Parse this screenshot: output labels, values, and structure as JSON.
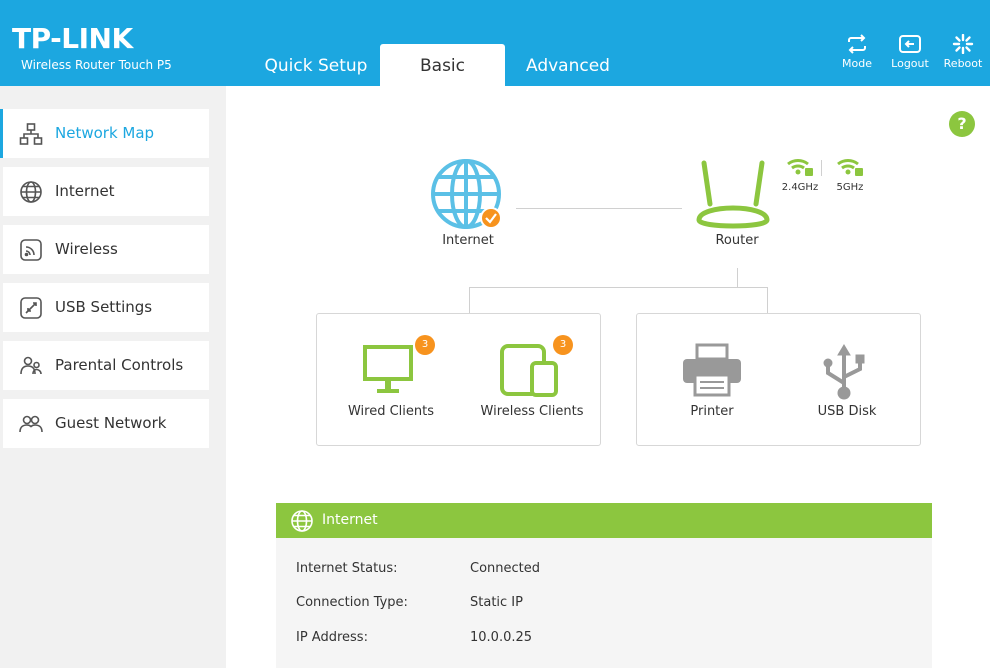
{
  "header": {
    "logo": "TP-LINK",
    "model": "Wireless Router Touch P5",
    "tabs": {
      "quick_setup": "Quick Setup",
      "basic": "Basic",
      "advanced": "Advanced"
    },
    "buttons": {
      "mode": "Mode",
      "logout": "Logout",
      "reboot": "Reboot"
    }
  },
  "sidebar": {
    "items": [
      {
        "label": "Network Map",
        "icon": "network-map-icon",
        "active": true
      },
      {
        "label": "Internet",
        "icon": "globe-icon"
      },
      {
        "label": "Wireless",
        "icon": "wireless-icon"
      },
      {
        "label": "USB Settings",
        "icon": "usb-settings-icon"
      },
      {
        "label": "Parental Controls",
        "icon": "parental-controls-icon"
      },
      {
        "label": "Guest Network",
        "icon": "guest-network-icon"
      }
    ]
  },
  "map": {
    "internet_label": "Internet",
    "router_label": "Router",
    "band_24": "2.4GHz",
    "band_5": "5GHz",
    "wired_clients_label": "Wired Clients",
    "wired_clients_count": "3",
    "wireless_clients_label": "Wireless Clients",
    "wireless_clients_count": "3",
    "printer_label": "Printer",
    "usb_disk_label": "USB Disk",
    "help": "?"
  },
  "internet_panel": {
    "title": "Internet",
    "rows": [
      {
        "label": "Internet Status:",
        "value": "Connected"
      },
      {
        "label": "Connection Type:",
        "value": "Static IP"
      },
      {
        "label": "IP Address:",
        "value": "10.0.0.25"
      }
    ]
  },
  "colors": {
    "header_blue": "#1ca7e0",
    "accent_green": "#8cc63f",
    "badge_orange": "#f7931e",
    "globe_blue": "#5bc0e6"
  }
}
